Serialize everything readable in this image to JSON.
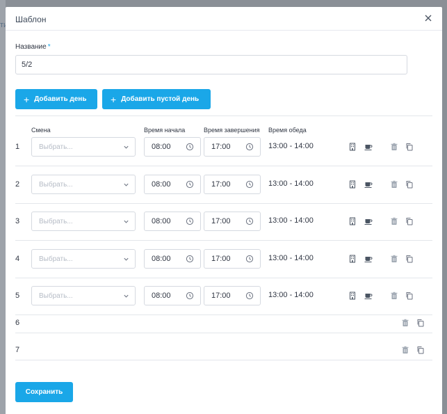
{
  "background": {
    "text": "ти"
  },
  "modal": {
    "title": "Шаблон",
    "name_label": "Название",
    "required_mark": "*",
    "name_value": "5/2",
    "add_day_label": "Добавить день",
    "add_empty_day_label": "Добавить пустой день",
    "save_label": "Сохранить"
  },
  "columns": {
    "shift": "Смена",
    "start": "Время начала",
    "end": "Время завершения",
    "lunch": "Время обеда"
  },
  "rows": [
    {
      "num": "1",
      "placeholder": "Выбрать...",
      "start": "08:00",
      "end": "17:00",
      "lunch": "13:00 - 14:00"
    },
    {
      "num": "2",
      "placeholder": "Выбрать...",
      "start": "08:00",
      "end": "17:00",
      "lunch": "13:00 - 14:00"
    },
    {
      "num": "3",
      "placeholder": "Выбрать...",
      "start": "08:00",
      "end": "17:00",
      "lunch": "13:00 - 14:00"
    },
    {
      "num": "4",
      "placeholder": "Выбрать...",
      "start": "08:00",
      "end": "17:00",
      "lunch": "13:00 - 14:00"
    },
    {
      "num": "5",
      "placeholder": "Выбрать...",
      "start": "08:00",
      "end": "17:00",
      "lunch": "13:00 - 14:00"
    }
  ],
  "empty_rows": [
    {
      "num": "6"
    },
    {
      "num": "7"
    }
  ],
  "colors": {
    "accent": "#1aa7e8",
    "icon": "#8d96a3",
    "icon_dark": "#4b5563"
  },
  "icons": [
    "close-icon",
    "plus-icon",
    "chevron-down-icon",
    "clock-icon",
    "building-icon",
    "coffee-cup-icon",
    "trash-icon",
    "copy-icon"
  ]
}
